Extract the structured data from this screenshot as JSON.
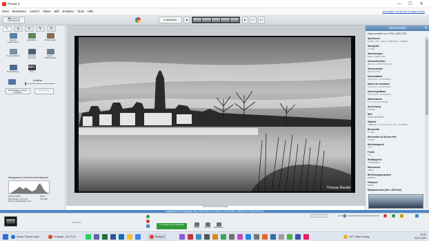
{
  "window": {
    "title": "Picasa 3",
    "minimize": "—",
    "maximize": "☐",
    "close": "✕"
  },
  "menu": {
    "items": [
      "Datei",
      "Bearbeiten",
      "Ansicht",
      "Album",
      "Bild",
      "Erstellen",
      "Tools",
      "Hilfe"
    ],
    "signin": "Anmelden mit Ihrem Google-Konto"
  },
  "toolbar": {
    "back_label": "Zurück zur Fotoübersicht",
    "play_label": "Abspielen",
    "view_a": "1:1",
    "view_b": "2:2"
  },
  "leftpanel": {
    "tools": [
      {
        "label": "Einfach zuschneiden",
        "icon": "crop-icon"
      },
      {
        "label": "Ausrichten",
        "icon": "straighten-icon"
      },
      {
        "label": "Rote Augen",
        "icon": "redeye-icon"
      },
      {
        "label": "Auf gut Glück!",
        "icon": "lucky-icon"
      },
      {
        "label": "Automat. Kontrast",
        "icon": "contrast-icon"
      },
      {
        "label": "Autom. Farbkorrektur",
        "icon": "color-icon"
      },
      {
        "label": "Retuschieren",
        "icon": "retouch-icon"
      },
      {
        "label": "Text",
        "icon": "text-icon"
      }
    ],
    "fill_light_label": "Aufhellen",
    "undo_label": "Rückgängig machen: Aufhellen",
    "redo_label": "Wiederholen",
    "histogram_title": "Histogramm & Kamera-Informationen",
    "camera_info": [
      "NIKON D300",
      "Brennweite: 11,0 mm",
      "1/50 sec Belichtung: 10 s",
      "ISO 200"
    ],
    "camera_values": [
      "f/22,0",
      "ISO 200"
    ]
  },
  "center": {
    "caption": "Bildunterschrift hinzufügen",
    "watermark": "Thomas Bauder"
  },
  "rightpanel": {
    "header": "Eigenschaften",
    "filename": "Eigenschaften von TOM_0259.JPG",
    "props": [
      {
        "k": "Speicherort",
        "v": "D:\\Ext - 001 - ALLE Fotos\\2010 - Fotoalb..."
      },
      {
        "k": "Dateigröße",
        "v": "2,5 MB"
      },
      {
        "k": "Abmessungen",
        "v": "4288 x 2848 Pixel"
      },
      {
        "k": "Kamerahersteller",
        "v": "NIKON CORPORATION"
      },
      {
        "k": "Kameramodell",
        "v": "NIKON D300"
      },
      {
        "k": "Kameradatum",
        "v": "2010:12:07 14:18:46:62"
      },
      {
        "k": "Datum der Aufnahme",
        "v": "2010:12:07 14:18:46:62"
      },
      {
        "k": "Änderungsdatum",
        "v": "2010:12:07 14:18:46:62"
      },
      {
        "k": "Datumskunde",
        "v": "07.12.2010 14:18:46"
      },
      {
        "k": "Ausrichtung",
        "v": "Normal"
      },
      {
        "k": "Blitz",
        "v": "Nicht verwendet"
      },
      {
        "k": "Objektiv",
        "v": "Tokina AT-X 116 PRO DX (AF 11-16mm f/..."
      },
      {
        "k": "Brennweite",
        "v": "11 mm"
      },
      {
        "k": "Brennweite bei 35-mm-Film",
        "v": "16 mm"
      },
      {
        "k": "Belichtungszeit",
        "v": "25 s"
      },
      {
        "k": "F-Zahl",
        "v": "f/22"
      },
      {
        "k": "Weißabgleich",
        "v": "Automatisch"
      },
      {
        "k": "Messmodus",
        "v": "Matrix"
      },
      {
        "k": "Belichtungsprogramm",
        "v": "Manuell"
      },
      {
        "k": "Farbraum",
        "v": "sRGB"
      },
      {
        "k": "Miniaturansicht (160 x 106 Pixel)",
        "v": ""
      }
    ]
  },
  "statusbar": {
    "text": "Ausgewählt: Bild angezeigt   TOM_0259.JPG   07.12.2010 14:18:46   4288 x 2848 Pixel   2,5 MB   (Pixel 0)"
  },
  "tray": {
    "selection_label": "Auswahl",
    "green_button": "In Google Fotos hochladen",
    "actions": [
      {
        "label": "E-Mail",
        "icon": "email-icon"
      },
      {
        "label": "Drucken",
        "icon": "print-icon"
      },
      {
        "label": "Exportieren",
        "icon": "export-icon"
      }
    ]
  },
  "taskbar": {
    "items": [
      {
        "label": "Neues Thema erstel...",
        "color": "#1f6fd1"
      },
      {
        "label": "Prospekt - 24.07.20...",
        "color": "#d9451f"
      },
      {
        "label": "Picasa 3",
        "color": "#e63b2e"
      }
    ],
    "weather": "19°C  Teilw. sonnig",
    "time": "10:03",
    "date": "25.07.2023"
  }
}
